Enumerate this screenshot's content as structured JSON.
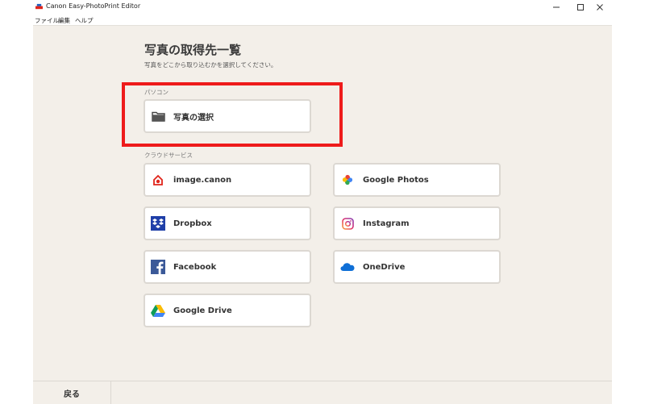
{
  "window": {
    "title": "Canon Easy-PhotoPrint Editor"
  },
  "menu": {
    "items": [
      "ファイル",
      "編集",
      "ヘルプ"
    ]
  },
  "page": {
    "title": "写真の取得先一覧",
    "subtitle": "写真をどこから取り込むかを選択してください。"
  },
  "sections": {
    "pc": {
      "label": "パソコン",
      "items": [
        {
          "label": "写真の選択",
          "icon": "folder-icon"
        }
      ]
    },
    "cloud": {
      "label": "クラウドサービス",
      "items": [
        {
          "label": "image.canon",
          "icon": "image-canon-icon"
        },
        {
          "label": "Google Photos",
          "icon": "google-photos-icon"
        },
        {
          "label": "Dropbox",
          "icon": "dropbox-icon"
        },
        {
          "label": "Instagram",
          "icon": "instagram-icon"
        },
        {
          "label": "Facebook",
          "icon": "facebook-icon"
        },
        {
          "label": "OneDrive",
          "icon": "onedrive-icon"
        },
        {
          "label": "Google Drive",
          "icon": "google-drive-icon"
        }
      ]
    }
  },
  "footer": {
    "back_label": "戻る"
  },
  "colors": {
    "highlight": "#ee1b1b",
    "background": "#f3efe9",
    "dropbox": "#1f3fa8",
    "facebook": "#3b5998",
    "onedrive": "#0f6fd6",
    "image_canon": "#e0251b"
  }
}
